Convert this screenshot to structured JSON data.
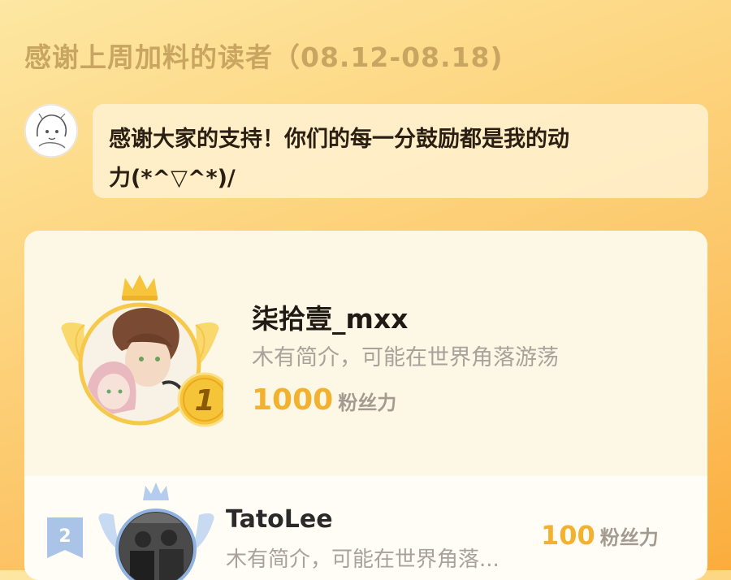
{
  "header": {
    "title": "感谢上周加料的读者（08.12-08.18)"
  },
  "author": {
    "message_line1": "感谢大家的支持！你们的每一分鼓励都是我的动",
    "message_line2": "力(*^▽^*)/"
  },
  "ranking": [
    {
      "rank": "1",
      "name": "柒拾壹_mxx",
      "bio": "木有简介，可能在世界角落游荡",
      "score": "1000",
      "unit": "粉丝力"
    },
    {
      "rank": "2",
      "name": "TatoLee",
      "bio": "木有简介，可能在世界角落...",
      "score": "100",
      "unit": "粉丝力"
    }
  ],
  "colors": {
    "gold": "#f2b230",
    "silver_blue": "#9fbfe3",
    "title": "#c9a562"
  }
}
